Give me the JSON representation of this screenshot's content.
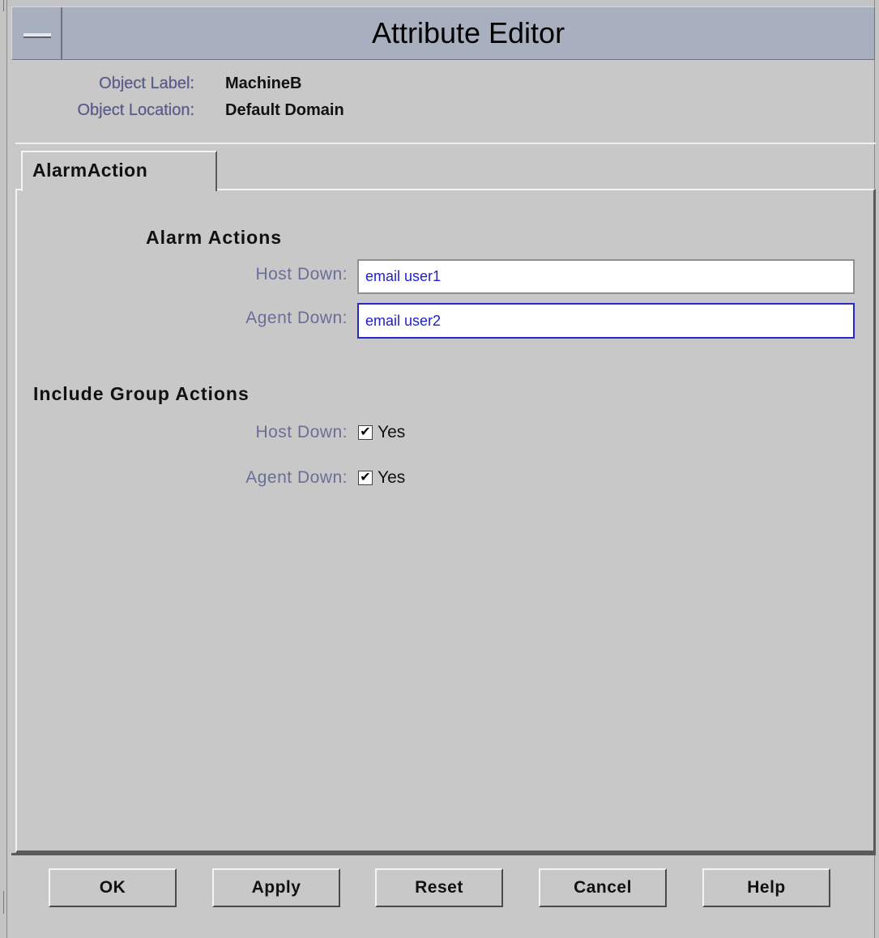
{
  "window": {
    "title": "Attribute Editor"
  },
  "object_info": {
    "label_caption": "Object Label:",
    "label_value": "MachineB",
    "location_caption": "Object Location:",
    "location_value": "Default Domain"
  },
  "tabs": [
    {
      "label": "AlarmAction",
      "selected": true
    }
  ],
  "alarm_actions": {
    "title": "Alarm Actions",
    "host_down_label": "Host Down:",
    "host_down_value": "email user1",
    "agent_down_label": "Agent Down:",
    "agent_down_value": "email user2"
  },
  "group_actions": {
    "title": "Include Group Actions",
    "host_down_label": "Host Down:",
    "host_down_checked": true,
    "host_down_option": "Yes",
    "agent_down_label": "Agent Down:",
    "agent_down_checked": true,
    "agent_down_option": "Yes"
  },
  "buttons": {
    "ok": "OK",
    "apply": "Apply",
    "reset": "Reset",
    "cancel": "Cancel",
    "help": "Help"
  },
  "colors": {
    "title_bar": "#a8b0c0",
    "label_text": "#6a6e98",
    "input_text": "#2020d0",
    "focus_border": "#2828c8",
    "background": "#c8c8c8"
  }
}
